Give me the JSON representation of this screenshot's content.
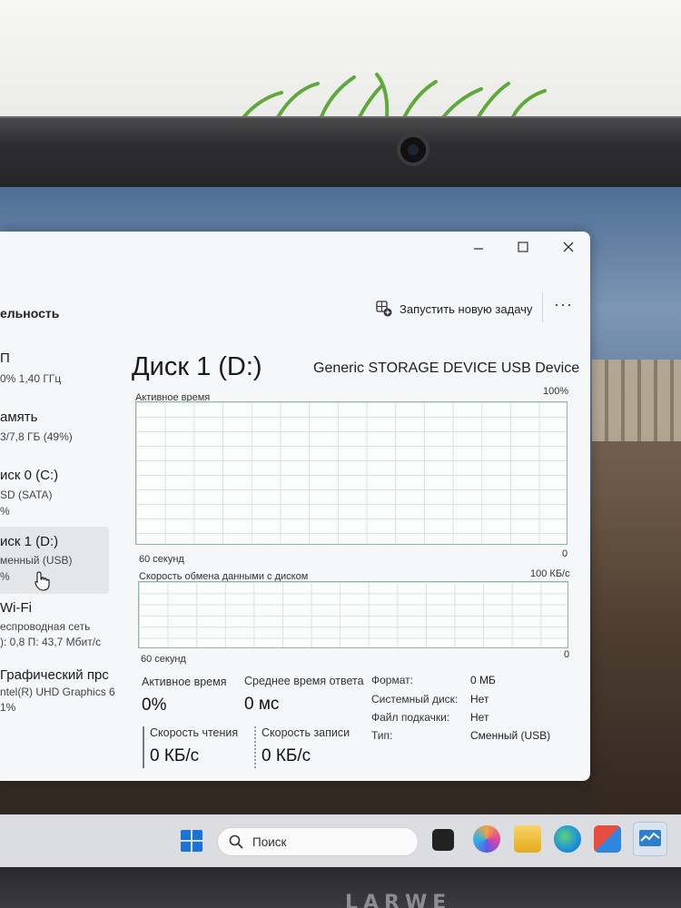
{
  "toolbar": {
    "page_title": "ельность",
    "run_task": "Запустить новую задачу",
    "more": "···"
  },
  "sidebar": {
    "items": [
      {
        "name": "П",
        "sub1": "0% 1,40 ГГц",
        "sub2": ""
      },
      {
        "name": "амять",
        "sub1": "3/7,8 ГБ (49%)",
        "sub2": ""
      },
      {
        "name": "иск 0 (C:)",
        "sub1": "SD (SATA)",
        "sub2": "%"
      },
      {
        "name": "иск 1 (D:)",
        "sub1": "менный (USB)",
        "sub2": "%"
      },
      {
        "name": "Wi-Fi",
        "sub1": "еспроводная сеть",
        "sub2": "): 0,8 П: 43,7 Мбит/с"
      },
      {
        "name": "Графический прс",
        "sub1": "ntel(R) UHD Graphics 6",
        "sub2": "1%"
      }
    ]
  },
  "main": {
    "title": "Диск 1 (D:)",
    "model": "Generic STORAGE DEVICE USB Device",
    "graph1": {
      "label": "Активное время",
      "max": "100%",
      "time": "60 секунд",
      "min": "0"
    },
    "graph2": {
      "label": "Скорость обмена данными с диском",
      "max": "100 КБ/с",
      "time": "60 секунд",
      "min": "0"
    },
    "stats": {
      "active_label": "Активное время",
      "active_value": "0%",
      "resp_label": "Среднее время ответа",
      "resp_value": "0 мс",
      "read_label": "Скорость чтения",
      "read_value": "0 КБ/с",
      "write_label": "Скорость записи",
      "write_value": "0 КБ/с"
    },
    "props": [
      {
        "key": "Формат:",
        "value": "0 МБ"
      },
      {
        "key": "Системный диск:",
        "value": "Нет"
      },
      {
        "key": "Файл подкачки:",
        "value": "Нет"
      },
      {
        "key": "Тип:",
        "value": "Сменный (USB)"
      }
    ]
  },
  "taskbar": {
    "search_placeholder": "Поиск"
  },
  "bezel": {
    "brand": "LARWE"
  }
}
